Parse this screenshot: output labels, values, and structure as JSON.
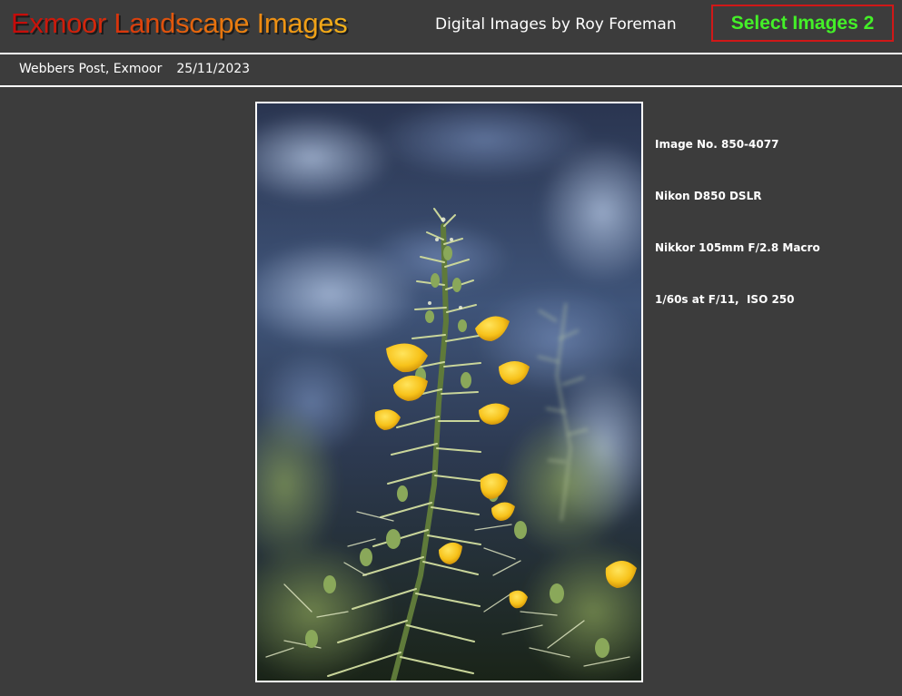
{
  "header": {
    "title": "Exmoor Landscape Images",
    "subtitle": "Digital Images by Roy Foreman",
    "select_button": "Select Images 2"
  },
  "location": {
    "place": "Webbers Post, Exmoor",
    "date": "25/11/2023"
  },
  "photo": {
    "info_lines": [
      "Image No. 850-4077",
      "Nikon D850 DSLR",
      "Nikkor 105mm F/2.8 Macro",
      "1/60s at F/11,  ISO 250"
    ]
  },
  "colors": {
    "background": "#3c3c3c",
    "title_gradient_start": "#c40a0a",
    "title_gradient_end": "#f3b21a",
    "select_text": "#44f028",
    "select_border": "#d01818"
  }
}
